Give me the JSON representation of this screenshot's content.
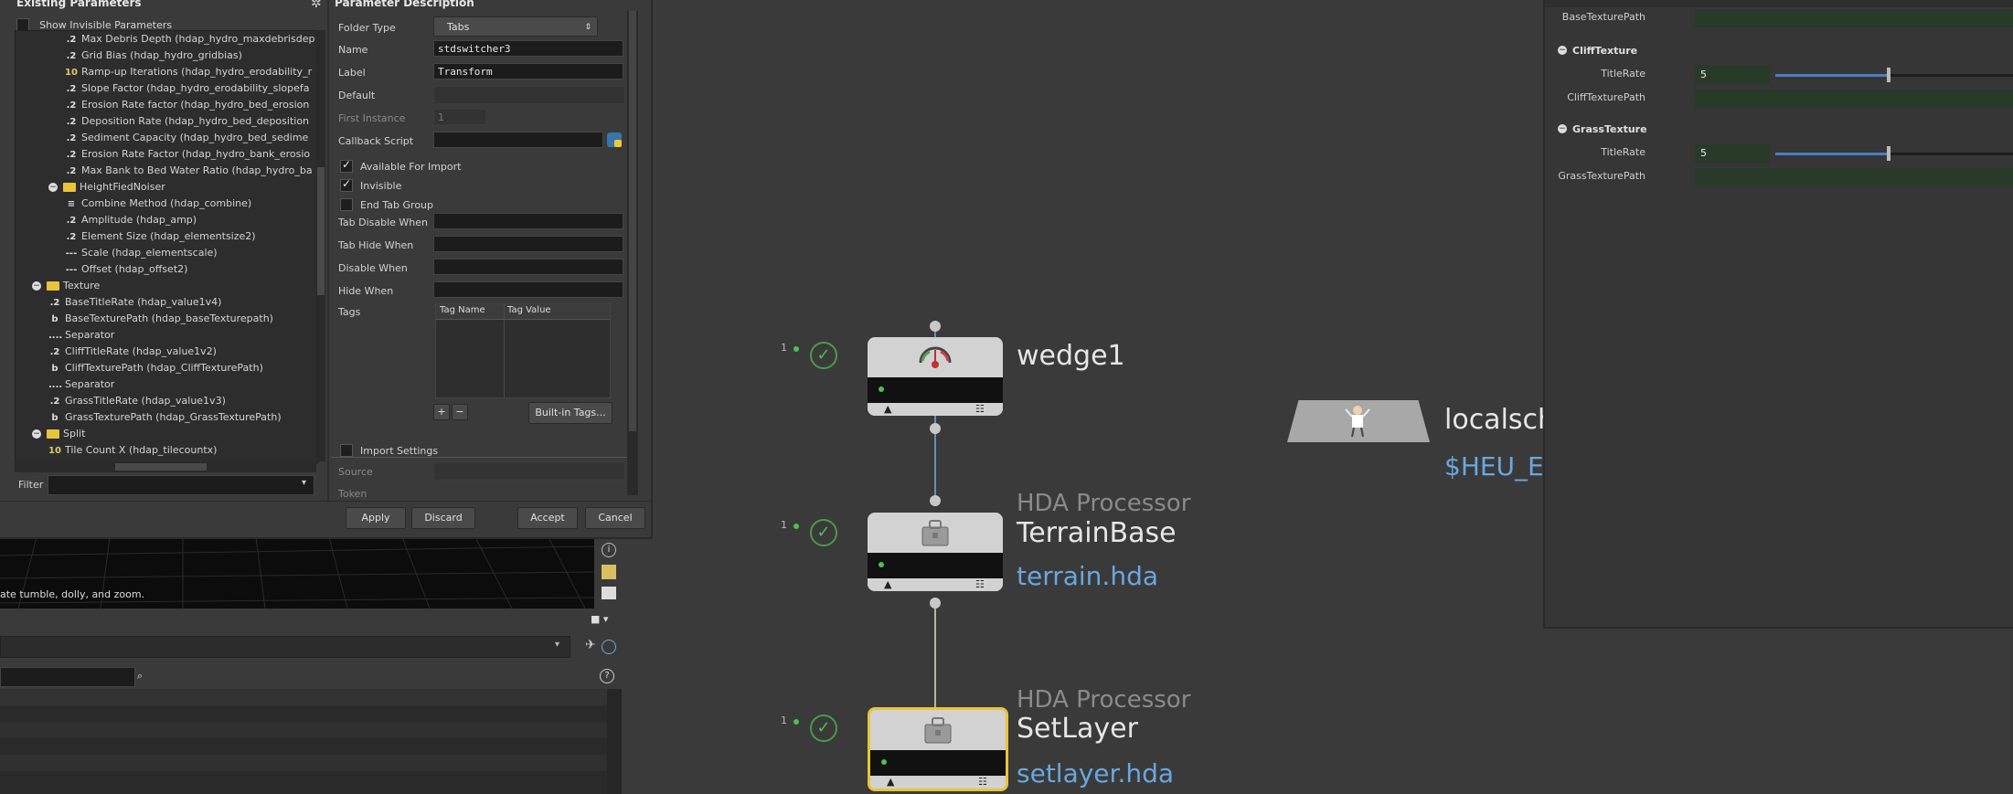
{
  "dialog": {
    "existing_title": "Existing Parameters",
    "show_invisible_label": "Show Invisible Parameters",
    "filter_label": "Filter",
    "tree": [
      {
        "icon": ".2",
        "label": "Max Debris Depth (hdap_hydro_maxdebrisdep",
        "indent": 3
      },
      {
        "icon": ".2",
        "label": "Grid Bias (hdap_hydro_gridbias)",
        "indent": 3
      },
      {
        "icon": "10",
        "label": "Ramp-up Iterations (hdap_hydro_erodability_r",
        "indent": 3
      },
      {
        "icon": ".2",
        "label": "Slope Factor (hdap_hydro_erodability_slopefa",
        "indent": 3
      },
      {
        "icon": ".2",
        "label": "Erosion Rate factor (hdap_hydro_bed_erosion",
        "indent": 3
      },
      {
        "icon": ".2",
        "label": "Deposition Rate (hdap_hydro_bed_deposition",
        "indent": 3
      },
      {
        "icon": ".2",
        "label": "Sediment Capacity (hdap_hydro_bed_sedime",
        "indent": 3
      },
      {
        "icon": ".2",
        "label": "Erosion Rate Factor (hdap_hydro_bank_erosio",
        "indent": 3
      },
      {
        "icon": ".2",
        "label": "Max Bank to Bed Water Ratio (hdap_hydro_ba",
        "indent": 3
      },
      {
        "icon": "folder",
        "label": "HeightFiedNoiser",
        "indent": 2
      },
      {
        "icon": "≡",
        "label": "Combine Method (hdap_combine)",
        "indent": 3
      },
      {
        "icon": ".2",
        "label": "Amplitude (hdap_amp)",
        "indent": 3
      },
      {
        "icon": ".2",
        "label": "Element Size (hdap_elementsize2)",
        "indent": 3
      },
      {
        "icon": "---",
        "label": "Scale (hdap_elementscale)",
        "indent": 3
      },
      {
        "icon": "---",
        "label": "Offset (hdap_offset2)",
        "indent": 3
      },
      {
        "icon": "folder",
        "label": "Texture",
        "indent": 1
      },
      {
        "icon": ".2",
        "label": "BaseTitleRate (hdap_value1v4)",
        "indent": 2
      },
      {
        "icon": "b",
        "label": "BaseTexturePath (hdap_baseTexturepath)",
        "indent": 2
      },
      {
        "icon": "....",
        "label": "Separator",
        "indent": 2
      },
      {
        "icon": ".2",
        "label": "CliffTitleRate (hdap_value1v2)",
        "indent": 2
      },
      {
        "icon": "b",
        "label": "CliffTexturePath (hdap_CliffTexturePath)",
        "indent": 2
      },
      {
        "icon": "....",
        "label": "Separator",
        "indent": 2
      },
      {
        "icon": ".2",
        "label": "GrassTitleRate (hdap_value1v3)",
        "indent": 2
      },
      {
        "icon": "b",
        "label": "GrassTexturePath (hdap_GrassTexturePath)",
        "indent": 2
      },
      {
        "icon": "folder",
        "label": "Split",
        "indent": 1
      },
      {
        "icon": "10",
        "label": "Tile Count X (hdap_tilecountx)",
        "indent": 2
      }
    ],
    "desc_title": "Parameter Description",
    "fields": {
      "folder_type_label": "Folder Type",
      "folder_type_value": "Tabs",
      "name_label": "Name",
      "name_value": "stdswitcher3",
      "label_label": "Label",
      "label_value": "Transform",
      "default_label": "Default",
      "first_instance_label": "First Instance",
      "first_instance_value": "1",
      "callback_label": "Callback Script",
      "avail_import_label": "Available For Import",
      "invisible_label": "Invisible",
      "end_tab_label": "End Tab Group",
      "tab_disable_label": "Tab Disable When",
      "tab_hide_label": "Tab Hide When",
      "disable_when_label": "Disable When",
      "hide_when_label": "Hide When",
      "tags_label": "Tags",
      "tag_name_col": "Tag Name",
      "tag_value_col": "Tag Value",
      "builtin_tags": "Built-in Tags...",
      "import_settings_label": "Import Settings",
      "source_label": "Source",
      "token_label": "Token"
    },
    "buttons": {
      "apply": "Apply",
      "discard": "Discard",
      "accept": "Accept",
      "cancel": "Cancel"
    }
  },
  "viewport_hint": "ate tumble, dolly, and zoom.",
  "network": {
    "wedge": {
      "count": "1",
      "title": "wedge1"
    },
    "terrain": {
      "count": "1",
      "subtitle": "HDA Processor",
      "title": "TerrainBase",
      "file": "terrain.hda"
    },
    "setlayer": {
      "count": "1",
      "subtitle": "HDA Processor",
      "title": "SetLayer",
      "file": "setlayer.hda"
    },
    "localsch": {
      "title": "localsch",
      "path": "$HEU_EN"
    }
  },
  "params": {
    "base_path_label": "BaseTexturePath",
    "cliff_header": "CliffTexture",
    "cliff_rate_label": "TitleRate",
    "cliff_rate_value": "5",
    "cliff_path_label": "CliffTexturePath",
    "grass_header": "GrassTexture",
    "grass_rate_label": "TitleRate",
    "grass_rate_value": "5",
    "grass_path_label": "GrassTexturePath"
  },
  "colors": {
    "accent_green": "#4fbf4f",
    "file_blue": "#6aa7e0",
    "selected_yellow": "#e8c43a"
  }
}
